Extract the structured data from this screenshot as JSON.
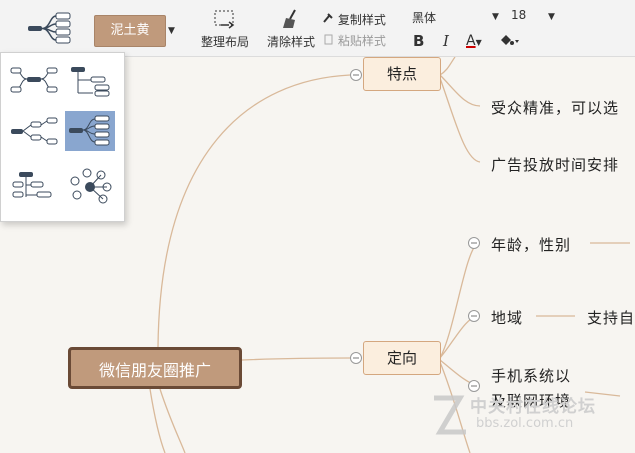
{
  "toolbar": {
    "theme_label": "泥土黄",
    "arrange_label": "整理布局",
    "clear_label": "清除样式",
    "copy_style_label": "复制样式",
    "paste_style_label": "粘贴样式",
    "font_name": "黑体",
    "font_size": "18",
    "bold_label": "B",
    "italic_label": "I",
    "font_color_label": "A"
  },
  "colors": {
    "accent": "#c09a7c",
    "branch": "#d9b99a",
    "root_border": "#6a4a36",
    "selected_layout": "#89a6cf"
  },
  "mindmap": {
    "root": "微信朋友圈推广",
    "nodes": {
      "features": "特点",
      "targeting": "定向"
    },
    "feature_items": [
      "受众精准，可以选",
      "广告投放时间安排"
    ],
    "targeting_items": {
      "age": "年龄，性别",
      "region": "地域",
      "region_sub": "支持自",
      "phone": "手机系统以",
      "network": "及联网环境"
    }
  },
  "watermark": {
    "brand": "中关村在线论坛",
    "url": "bbs.zol.com.cn"
  }
}
